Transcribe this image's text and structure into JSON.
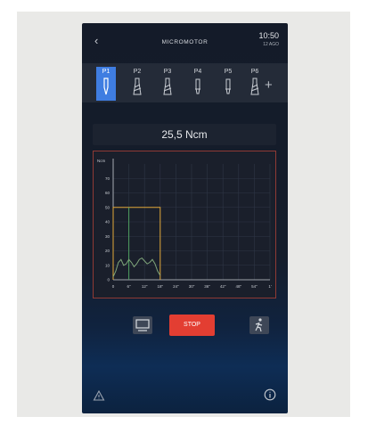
{
  "header": {
    "back_icon": "chevron-left-icon",
    "title": "MICROMOTOR",
    "time": "10:50",
    "date": "12 AGO"
  },
  "programs": [
    {
      "label": "P1",
      "icon": "drill-bit-icon",
      "selected": true
    },
    {
      "label": "P2",
      "icon": "drill-bit-icon",
      "selected": false
    },
    {
      "label": "P3",
      "icon": "drill-bit-icon",
      "selected": false
    },
    {
      "label": "P4",
      "icon": "implant-icon",
      "selected": false
    },
    {
      "label": "P5",
      "icon": "implant-icon",
      "selected": false
    },
    {
      "label": "P6",
      "icon": "drill-bit-icon",
      "selected": false
    }
  ],
  "add_program": "+",
  "torque_readout": "25,5 Ncm",
  "chart_data": {
    "type": "line",
    "ylabel": "Ncm",
    "y_ticks": [
      "70",
      "60",
      "50",
      "40",
      "30",
      "20",
      "10",
      "0"
    ],
    "x_ticks": [
      "6\"",
      "12\"",
      "18\"",
      "24\"",
      "30\"",
      "36\"",
      "42\"",
      "48\"",
      "54\"",
      "1'"
    ],
    "xlim": [
      0,
      60
    ],
    "ylim": [
      0,
      80
    ],
    "grid": true,
    "series": [
      {
        "color": "#e2a93a",
        "x": [
          0,
          0,
          18,
          18
        ],
        "y": [
          0,
          50,
          50,
          0
        ]
      },
      {
        "color": "#4fa061",
        "x": [
          6,
          6
        ],
        "y": [
          0,
          50
        ]
      },
      {
        "color": "#7fa57a",
        "x": [
          0,
          1,
          2,
          3,
          4,
          5,
          6,
          7,
          8,
          9,
          10,
          11,
          12,
          13,
          14,
          15,
          16,
          17,
          18
        ],
        "y": [
          2,
          6,
          12,
          14,
          10,
          11,
          14,
          12,
          9,
          11,
          14,
          15,
          13,
          11,
          12,
          14,
          11,
          6,
          3
        ]
      }
    ]
  },
  "actions": {
    "monitor_icon": "monitor-icon",
    "stop_label": "STOP",
    "run_icon": "running-figure-icon"
  },
  "footer": {
    "warning_icon": "warning-icon",
    "info_icon": "info-icon"
  },
  "colors": {
    "accent": "#3f7de1",
    "stop": "#e33e32",
    "chart_frame": "#8f3a34"
  }
}
